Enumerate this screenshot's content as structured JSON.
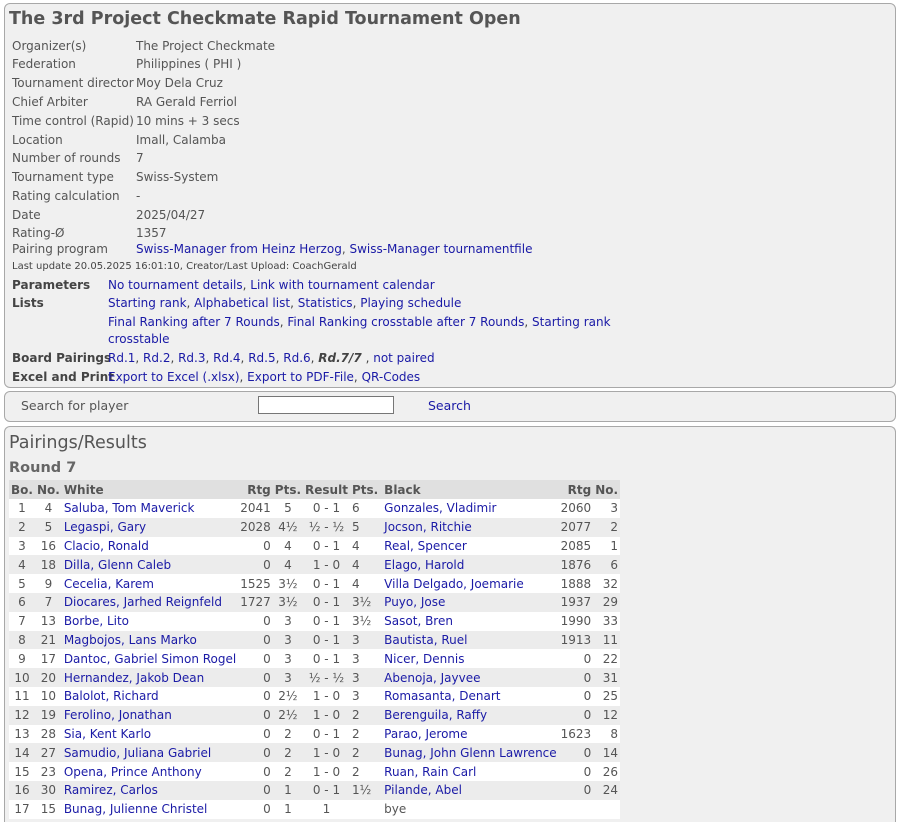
{
  "header": {
    "title": "The 3rd Project Checkmate Rapid Tournament Open"
  },
  "info": [
    {
      "k": "Organizer(s)",
      "v": "The Project Checkmate"
    },
    {
      "k": "Federation",
      "v": "Philippines ( PHI )"
    },
    {
      "k": "Tournament director",
      "v": "Moy Dela Cruz"
    },
    {
      "k": "Chief Arbiter",
      "v": "RA Gerald Ferriol"
    },
    {
      "k": "Time control (Rapid)",
      "v": "10 mins + 3 secs"
    },
    {
      "k": "Location",
      "v": "Imall, Calamba"
    },
    {
      "k": "Number of rounds",
      "v": "7"
    },
    {
      "k": "Tournament type",
      "v": "Swiss-System"
    },
    {
      "k": "Rating calculation",
      "v": "-"
    },
    {
      "k": "Date",
      "v": "2025/04/27"
    },
    {
      "k": "Rating-Ø",
      "v": "1357"
    },
    {
      "k": "Pairing program",
      "v": ""
    }
  ],
  "pairing_program": {
    "link1": "Swiss-Manager from Heinz Herzog",
    "link2": "Swiss-Manager tournamentfile"
  },
  "last_update": "Last update 20.05.2025 16:01:10, Creator/Last Upload: CoachGerald",
  "parameters": {
    "label": "Parameters",
    "link1": "No tournament details",
    "link2": "Link with tournament calendar"
  },
  "lists": {
    "label": "Lists",
    "l1": "Starting rank",
    "l2": "Alphabetical list",
    "l3": "Statistics",
    "l4": "Playing schedule",
    "l5": "Final Ranking after 7 Rounds",
    "l6": "Final Ranking crosstable after 7 Rounds",
    "l7": "Starting rank",
    "l7b": "crosstable"
  },
  "board_pairings": {
    "label": "Board Pairings",
    "r1": "Rd.1",
    "r2": "Rd.2",
    "r3": "Rd.3",
    "r4": "Rd.4",
    "r5": "Rd.5",
    "r6": "Rd.6",
    "r7": "Rd.7/7",
    "np": "not paired"
  },
  "excel_print": {
    "label": "Excel and Print",
    "e1": "Export to Excel (.xlsx)",
    "e2": "Export to PDF-File",
    "e3": "QR-Codes"
  },
  "search": {
    "label": "Search for player",
    "button": "Search",
    "value": ""
  },
  "results": {
    "title": "Pairings/Results",
    "round": "Round 7",
    "headers": [
      "Bo.",
      "No.",
      "White",
      "Rtg",
      "Pts.",
      "Result",
      "Pts.",
      "Black",
      "Rtg",
      "No."
    ],
    "rows": [
      [
        "1",
        "4",
        "Saluba, Tom Maverick",
        "2041",
        "5",
        "0 - 1",
        "6",
        "Gonzales, Vladimir",
        "2060",
        "3"
      ],
      [
        "2",
        "5",
        "Legaspi, Gary",
        "2028",
        "4½",
        "½ - ½",
        "5",
        "Jocson, Ritchie",
        "2077",
        "2"
      ],
      [
        "3",
        "16",
        "Clacio, Ronald",
        "0",
        "4",
        "0 - 1",
        "4",
        "Real, Spencer",
        "2085",
        "1"
      ],
      [
        "4",
        "18",
        "Dilla, Glenn Caleb",
        "0",
        "4",
        "1 - 0",
        "4",
        "Elago, Harold",
        "1876",
        "6"
      ],
      [
        "5",
        "9",
        "Cecelia, Karem",
        "1525",
        "3½",
        "0 - 1",
        "4",
        "Villa Delgado, Joemarie",
        "1888",
        "32"
      ],
      [
        "6",
        "7",
        "Diocares, Jarhed Reignfeld",
        "1727",
        "3½",
        "0 - 1",
        "3½",
        "Puyo, Jose",
        "1937",
        "29"
      ],
      [
        "7",
        "13",
        "Borbe, Lito",
        "0",
        "3",
        "0 - 1",
        "3½",
        "Sasot, Bren",
        "1990",
        "33"
      ],
      [
        "8",
        "21",
        "Magbojos, Lans Marko",
        "0",
        "3",
        "0 - 1",
        "3",
        "Bautista, Ruel",
        "1913",
        "11"
      ],
      [
        "9",
        "17",
        "Dantoc, Gabriel Simon Rogel",
        "0",
        "3",
        "0 - 1",
        "3",
        "Nicer, Dennis",
        "0",
        "22"
      ],
      [
        "10",
        "20",
        "Hernandez, Jakob Dean",
        "0",
        "3",
        "½ - ½",
        "3",
        "Abenoja, Jayvee",
        "0",
        "31"
      ],
      [
        "11",
        "10",
        "Balolot, Richard",
        "0",
        "2½",
        "1 - 0",
        "3",
        "Romasanta, Denart",
        "0",
        "25"
      ],
      [
        "12",
        "19",
        "Ferolino, Jonathan",
        "0",
        "2½",
        "1 - 0",
        "2",
        "Berenguila, Raffy",
        "0",
        "12"
      ],
      [
        "13",
        "28",
        "Sia, Kent Karlo",
        "0",
        "2",
        "0 - 1",
        "2",
        "Parao, Jerome",
        "1623",
        "8"
      ],
      [
        "14",
        "27",
        "Samudio, Juliana Gabriel",
        "0",
        "2",
        "1 - 0",
        "2",
        "Bunag, John Glenn Lawrence",
        "0",
        "14"
      ],
      [
        "15",
        "23",
        "Opena, Prince Anthony",
        "0",
        "2",
        "1 - 0",
        "2",
        "Ruan, Rain Carl",
        "0",
        "26"
      ],
      [
        "16",
        "30",
        "Ramirez, Carlos",
        "0",
        "1",
        "0 - 1",
        "1½",
        "Pilande, Abel",
        "0",
        "24"
      ],
      [
        "17",
        "15",
        "Bunag, Julienne Christel",
        "0",
        "1",
        "1",
        "",
        "bye",
        "",
        ""
      ]
    ]
  },
  "colors": {
    "link": "#1a1aa6",
    "panel": "#f0f0f0",
    "border": "#a8a8a8",
    "header_row": "#e0e0e0",
    "alt_row": "#ececec"
  }
}
